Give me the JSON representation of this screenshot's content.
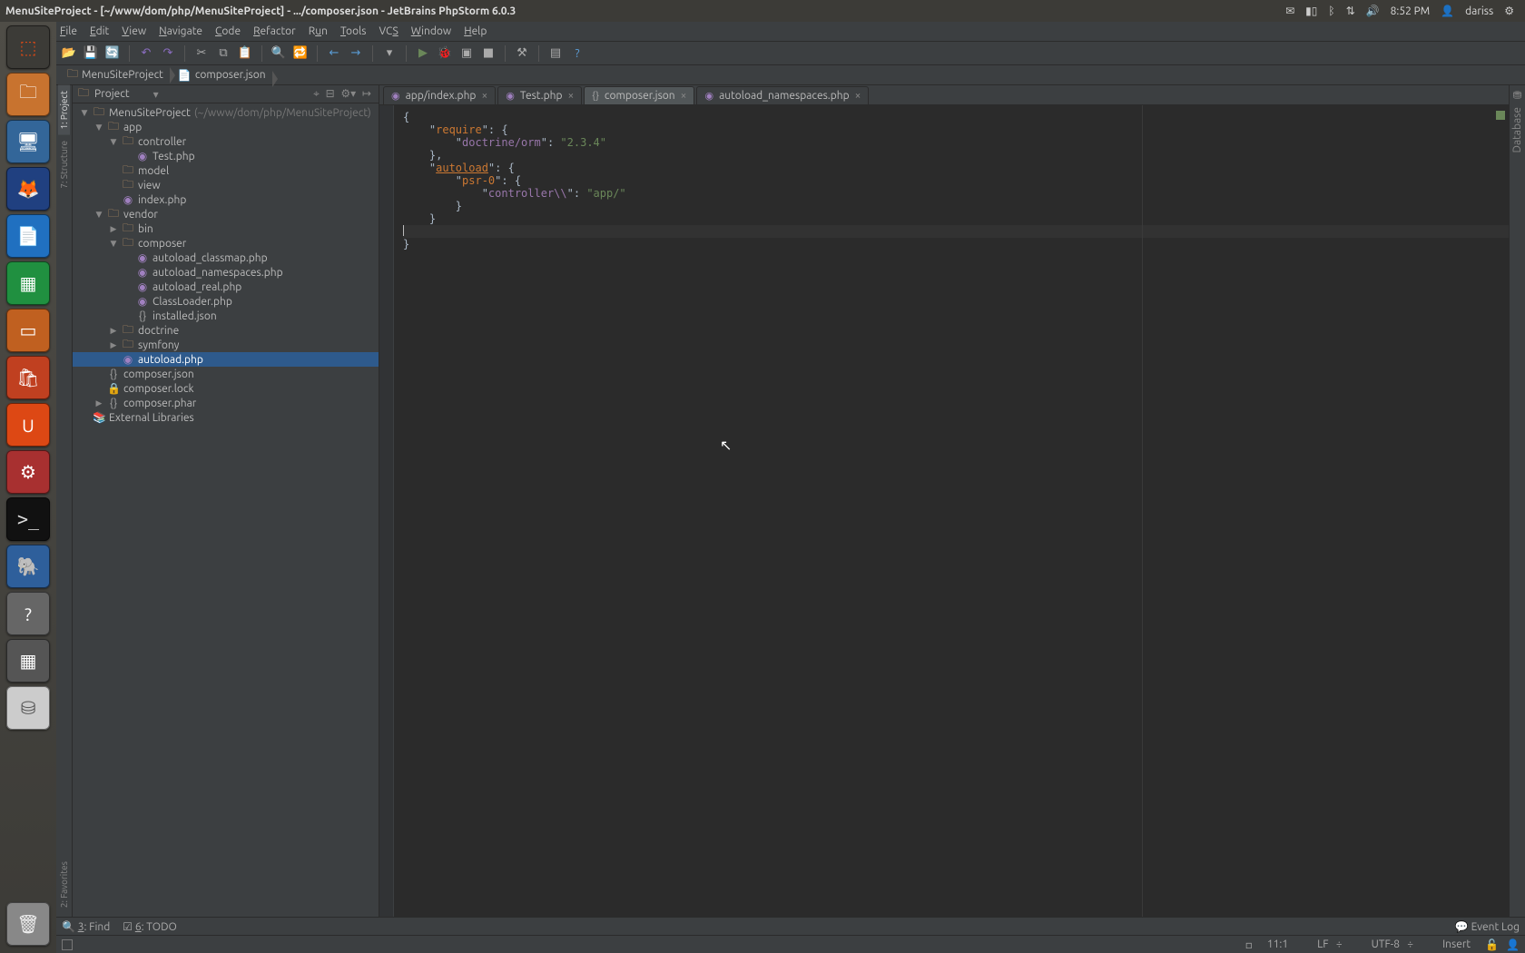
{
  "os": {
    "window_title": "MenuSiteProject - [~/www/dom/php/MenuSiteProject] - .../composer.json - JetBrains PhpStorm 6.0.3",
    "tray": {
      "time": "8:52 PM",
      "user": "dariss"
    },
    "tray_icons": [
      "mail",
      "battery",
      "bluetooth",
      "network",
      "volume",
      "time",
      "user",
      "gear"
    ],
    "launcher": [
      {
        "name": "dash",
        "label": "⬚"
      },
      {
        "name": "files",
        "label": "🗀"
      },
      {
        "name": "firefox",
        "label": "🦊"
      },
      {
        "name": "writer",
        "label": "📄"
      },
      {
        "name": "calc",
        "label": "▦"
      },
      {
        "name": "impress",
        "label": "▭"
      },
      {
        "name": "software",
        "label": "🛍"
      },
      {
        "name": "ubuntu-one",
        "label": "U"
      },
      {
        "name": "settings",
        "label": "⚙"
      },
      {
        "name": "terminal",
        "label": ">_"
      },
      {
        "name": "postgres",
        "label": "🐘"
      },
      {
        "name": "help",
        "label": "?"
      },
      {
        "name": "workspaces",
        "label": "▦"
      },
      {
        "name": "disk",
        "label": "⛁"
      }
    ]
  },
  "menu": [
    "File",
    "Edit",
    "View",
    "Navigate",
    "Code",
    "Refactor",
    "Run",
    "Tools",
    "VCS",
    "Window",
    "Help"
  ],
  "breadcrumbs": [
    {
      "icon": "dir",
      "label": "MenuSiteProject"
    },
    {
      "icon": "json",
      "label": "composer.json"
    }
  ],
  "project_panel": {
    "title": "Project",
    "tree": [
      {
        "depth": 0,
        "arrow": "▼",
        "icon": "dir",
        "label": "MenuSiteProject",
        "suffix": "(~/www/dom/php/MenuSiteProject)"
      },
      {
        "depth": 1,
        "arrow": "▼",
        "icon": "dir",
        "label": "app"
      },
      {
        "depth": 2,
        "arrow": "▼",
        "icon": "dir",
        "label": "controller"
      },
      {
        "depth": 3,
        "arrow": "",
        "icon": "php",
        "label": "Test.php"
      },
      {
        "depth": 2,
        "arrow": "",
        "icon": "dir",
        "label": "model"
      },
      {
        "depth": 2,
        "arrow": "",
        "icon": "dir",
        "label": "view"
      },
      {
        "depth": 2,
        "arrow": "",
        "icon": "php",
        "label": "index.php"
      },
      {
        "depth": 1,
        "arrow": "▼",
        "icon": "dir",
        "label": "vendor"
      },
      {
        "depth": 2,
        "arrow": "▶",
        "icon": "dir",
        "label": "bin"
      },
      {
        "depth": 2,
        "arrow": "▼",
        "icon": "dir",
        "label": "composer"
      },
      {
        "depth": 3,
        "arrow": "",
        "icon": "php",
        "label": "autoload_classmap.php"
      },
      {
        "depth": 3,
        "arrow": "",
        "icon": "php",
        "label": "autoload_namespaces.php"
      },
      {
        "depth": 3,
        "arrow": "",
        "icon": "php",
        "label": "autoload_real.php"
      },
      {
        "depth": 3,
        "arrow": "",
        "icon": "php",
        "label": "ClassLoader.php"
      },
      {
        "depth": 3,
        "arrow": "",
        "icon": "json",
        "label": "installed.json"
      },
      {
        "depth": 2,
        "arrow": "▶",
        "icon": "dir",
        "label": "doctrine"
      },
      {
        "depth": 2,
        "arrow": "▶",
        "icon": "dir",
        "label": "symfony"
      },
      {
        "depth": 2,
        "arrow": "",
        "icon": "php",
        "label": "autoload.php",
        "selected": true
      },
      {
        "depth": 1,
        "arrow": "",
        "icon": "json",
        "label": "composer.json"
      },
      {
        "depth": 1,
        "arrow": "",
        "icon": "lock",
        "label": "composer.lock"
      },
      {
        "depth": 1,
        "arrow": "▶",
        "icon": "json",
        "label": "composer.phar"
      },
      {
        "depth": 0,
        "arrow": "",
        "icon": "lib",
        "label": "External Libraries"
      }
    ]
  },
  "editor_tabs": [
    {
      "icon": "php",
      "label": "app/index.php"
    },
    {
      "icon": "php",
      "label": "Test.php"
    },
    {
      "icon": "json",
      "label": "composer.json",
      "active": true
    },
    {
      "icon": "php",
      "label": "autoload_namespaces.php"
    }
  ],
  "editor_content": {
    "lines": [
      "{",
      "    \"require\": {",
      "        \"doctrine/orm\": \"2.3.4\"",
      "    },",
      "    \"autoload\": {",
      "        \"psr-0\": {",
      "            \"controller\\\\\": \"app/\"",
      "        }",
      "    }",
      "",
      "}"
    ]
  },
  "side_tabs": {
    "left": [
      {
        "label": "1: Project",
        "active": true
      },
      {
        "label": "7: Structure"
      }
    ],
    "left_bottom": [
      {
        "label": "2: Favorites"
      }
    ],
    "right": [
      {
        "label": "Database"
      }
    ]
  },
  "bottom_tools": [
    {
      "icon": "🔍",
      "u": "3",
      "label": ": Find"
    },
    {
      "icon": "☑",
      "u": "6",
      "label": ": TODO"
    }
  ],
  "bottom_right": {
    "label": "Event Log",
    "icon": "💬"
  },
  "status": {
    "caret": "11:1",
    "line_sep": "LF",
    "encoding": "UTF-8",
    "insert": "Insert"
  }
}
